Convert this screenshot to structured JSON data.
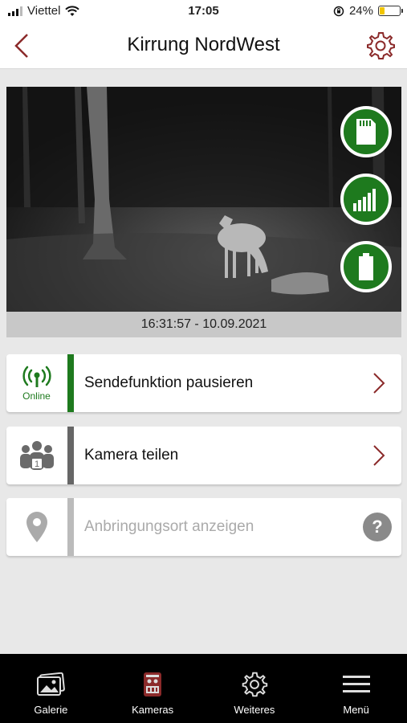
{
  "status_bar": {
    "carrier": "Viettel",
    "time": "17:05",
    "battery_percent": "24%",
    "battery_level": 0.24,
    "battery_color": "#f2c600"
  },
  "header": {
    "title": "Kirrung NordWest",
    "back_icon": "chevron-left-icon",
    "settings_icon": "gear-icon",
    "accent_color": "#8b2a2a"
  },
  "camera": {
    "timestamp": "16:31:57 - 10.09.2021",
    "status_icons": [
      "sd-card-icon",
      "signal-strength-icon",
      "battery-icon"
    ],
    "status_color": "#1e7a1e"
  },
  "rows": {
    "transmission": {
      "label": "Sendefunktion pausieren",
      "status": "Online",
      "icon": "antenna-icon",
      "stripe_color": "#1e7a1e"
    },
    "share": {
      "label": "Kamera teilen",
      "icon": "users-icon",
      "badge_count": "1",
      "stripe_color": "#666666"
    },
    "location": {
      "label": "Anbringungsort anzeigen",
      "icon": "location-pin-icon",
      "help_label": "?",
      "stripe_color": "#bbbbbb"
    }
  },
  "tabbar": {
    "items": [
      {
        "label": "Galerie",
        "icon": "gallery-icon"
      },
      {
        "label": "Kameras",
        "icon": "camera-device-icon",
        "active": true
      },
      {
        "label": "Weiteres",
        "icon": "gear-icon"
      },
      {
        "label": "Menü",
        "icon": "hamburger-menu-icon"
      }
    ]
  }
}
